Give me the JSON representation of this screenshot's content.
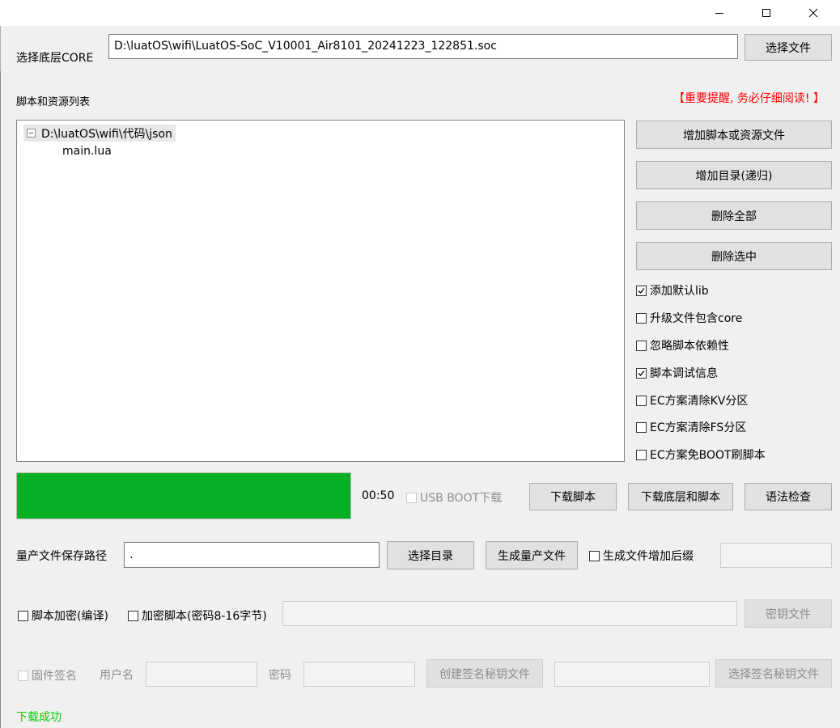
{
  "window": {
    "controls": [
      "minimize",
      "maximize",
      "close"
    ]
  },
  "core": {
    "label": "选择底层CORE",
    "path": "D:\\luatOS\\wifi\\LuatOS-SoC_V10001_Air8101_20241223_122851.soc",
    "select_button": "选择文件"
  },
  "scripts": {
    "label": "脚本和资源列表",
    "warning": "【重要提醒, 务必仔细阅读! 】",
    "tree": {
      "root": "D:\\luatOS\\wifi\\代码\\json",
      "children": [
        "main.lua"
      ]
    },
    "buttons": {
      "add_file": "增加脚本或资源文件",
      "add_dir": "增加目录(递归)",
      "delete_all": "删除全部",
      "delete_selected": "删除选中"
    },
    "options": [
      {
        "label": "添加默认lib",
        "checked": true
      },
      {
        "label": "升级文件包含core",
        "checked": false
      },
      {
        "label": "忽略脚本依赖性",
        "checked": false
      },
      {
        "label": "脚本调试信息",
        "checked": true
      },
      {
        "label": "EC方案清除KV分区",
        "checked": false
      },
      {
        "label": "EC方案清除FS分区",
        "checked": false
      },
      {
        "label": "EC方案免BOOT刷脚本",
        "checked": false
      }
    ]
  },
  "download": {
    "progress": 1.0,
    "time": "00:50",
    "usb_boot": "USB BOOT下载",
    "download_script": "下载脚本",
    "download_core_and_script": "下载底层和脚本",
    "syntax_check": "语法检查"
  },
  "mass": {
    "label": "量产文件保存路径",
    "path": ".",
    "select_dir": "选择目录",
    "generate": "生成量产文件",
    "suffix_label": "生成文件增加后缀",
    "suffix_value": ""
  },
  "encrypt": {
    "compile": "脚本加密(编译)",
    "password": "加密脚本(密码8-16字节)",
    "password_value": "",
    "key_file": "密钥文件"
  },
  "sign": {
    "firmware_sign": "固件签名",
    "username_label": "用户名",
    "password_label": "密码",
    "create_key": "创建签名秘钥文件",
    "select_key": "选择签名秘钥文件"
  },
  "status": {
    "message": "下载成功"
  },
  "colors": {
    "progress": "#06b025",
    "warning": "#ff0000",
    "success": "#00d000"
  }
}
